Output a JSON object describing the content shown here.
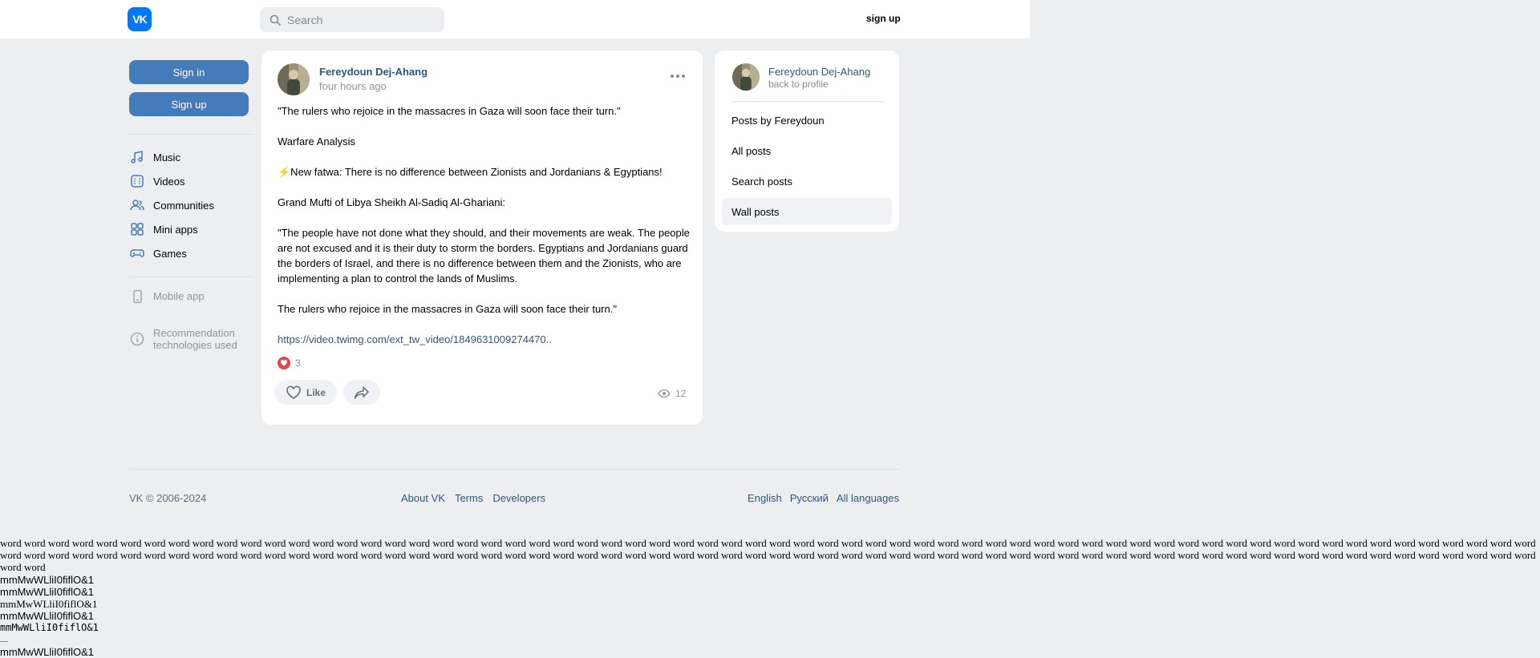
{
  "header": {
    "logo": "VK",
    "search_placeholder": "Search",
    "signup_label": "sign up"
  },
  "sidebar": {
    "signin_label": "Sign in",
    "signup_label": "Sign up",
    "items": [
      {
        "label": "Music",
        "icon": "music-note-icon"
      },
      {
        "label": "Videos",
        "icon": "video-icon"
      },
      {
        "label": "Communities",
        "icon": "users-icon"
      },
      {
        "label": "Mini apps",
        "icon": "grid-icon"
      },
      {
        "label": "Games",
        "icon": "gamepad-icon"
      }
    ],
    "mobile_app": "Mobile app",
    "recommendation_line1": "Recommendation",
    "recommendation_line2": "technologies used"
  },
  "post": {
    "author": "Fereydoun Dej-Ahang",
    "time": "four hours ago",
    "paragraphs": [
      "\"The rulers who rejoice in the massacres in Gaza will soon face their turn.\"",
      "Warfare Analysis",
      "⚡New fatwa: There is no difference between Zionists and Jordanians & Egyptians!",
      "Grand Mufti of Libya Sheikh Al-Sadiq Al-Ghariani:",
      "\"The people have not done what they should, and their movements are weak. The people are not excused and it is their duty to storm the borders. Egyptians and Jordanians guard the borders of Israel, and there is no difference between them and the Zionists, who are implementing a plan to control the lands of Muslims.",
      "The rulers who rejoice in the massacres in Gaza will soon face their turn.\""
    ],
    "link": "https://video.twimg.com/ext_tw_video/1849631009274470..",
    "likes_count": "3",
    "like_label": "Like",
    "views_count": "12"
  },
  "profile_card": {
    "author": "Fereydoun Dej-Ahang",
    "back": "back to profile",
    "items": [
      "Posts by Fereydoun",
      "All posts",
      "Search posts",
      "Wall posts"
    ],
    "active_item": "Wall posts"
  },
  "footer": {
    "copyright": "VK © 2006-2024",
    "links": [
      "About VK",
      "Terms",
      "Developers"
    ],
    "languages": [
      "English",
      "Русский",
      "All languages"
    ]
  },
  "raw_text": {
    "words_line": "word word word word word word word word word word word word word word word word word word word word word word word word word word word word word word word word word word word word word word word word word word word word word word word word word word word word word word word word word word word word word word word word word word word word word word word word word word word word word word word word word word word word word word word word word word word word word word word word word word word word word word word word word word word word word word word word word word word word word word word word word word word word word word word word word word",
    "mono_lines": [
      "mmMwWLliI0fiflO&1",
      "mmMwWLliI0fiflO&1",
      "mmMwWLliI0fiflO&1",
      "mmMwWLliI0fiflO&1",
      "mmMwWLliI0fiflO&1",
      "mmMwWLliI0fiflO&1"
    ]
  }
}
